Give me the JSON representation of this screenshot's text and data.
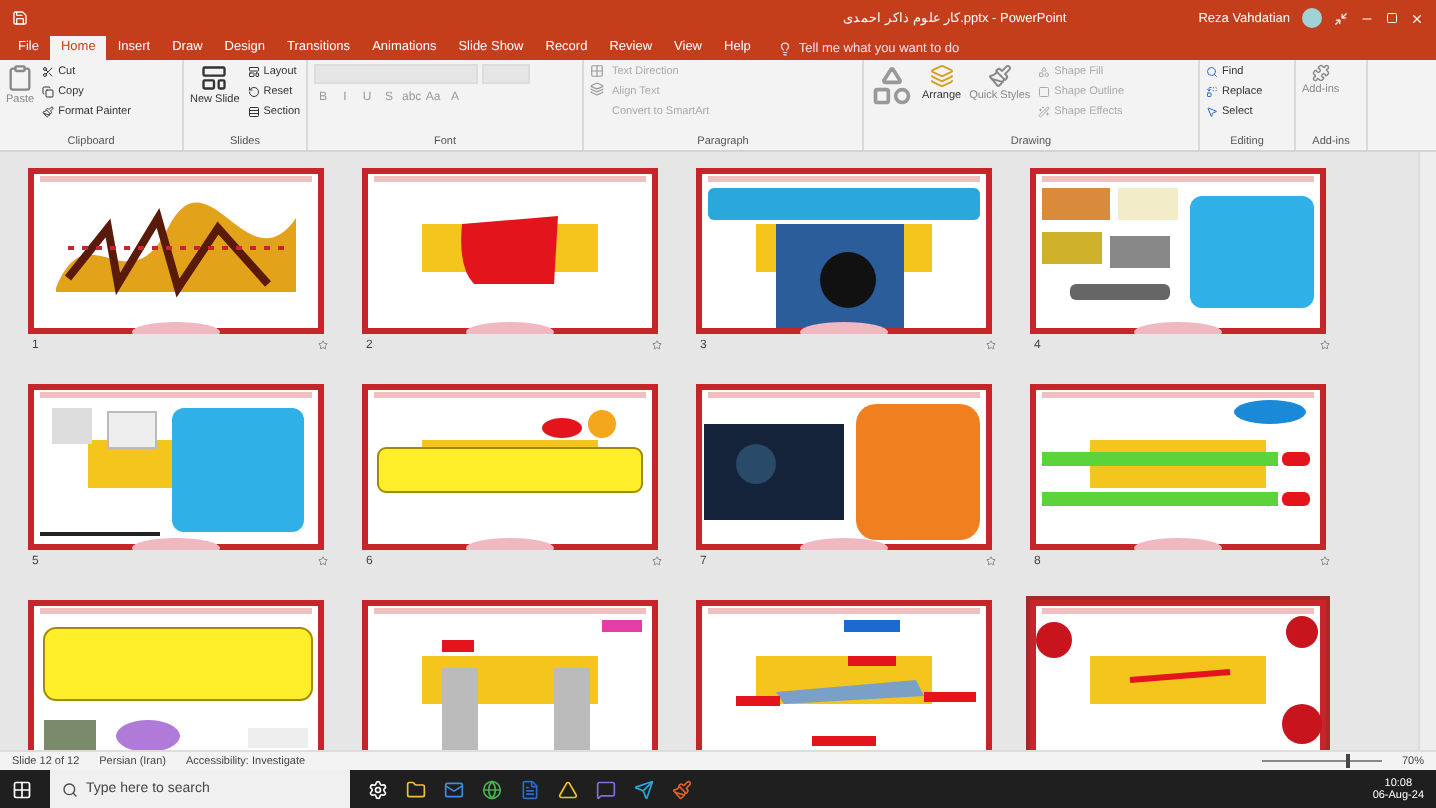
{
  "window": {
    "title": "کار علوم ذاکر احمدی.pptx - PowerPoint",
    "user": "Reza Vahdatian"
  },
  "tabs": [
    {
      "label": "File",
      "selected": false
    },
    {
      "label": "Home",
      "selected": true
    },
    {
      "label": "Insert",
      "selected": false
    },
    {
      "label": "Draw",
      "selected": false
    },
    {
      "label": "Design",
      "selected": false
    },
    {
      "label": "Transitions",
      "selected": false
    },
    {
      "label": "Animations",
      "selected": false
    },
    {
      "label": "Slide Show",
      "selected": false
    },
    {
      "label": "Record",
      "selected": false
    },
    {
      "label": "Review",
      "selected": false
    },
    {
      "label": "View",
      "selected": false
    },
    {
      "label": "Help",
      "selected": false
    }
  ],
  "tell_me": {
    "placeholder": "Tell me what you want to do"
  },
  "ribbon": {
    "clipboard": {
      "label": "Clipboard",
      "paste": "Paste",
      "items": [
        "Cut",
        "Copy",
        "Format Painter"
      ]
    },
    "slides": {
      "label": "Slides",
      "new_slide": "New Slide",
      "items": [
        "Layout",
        "Reset",
        "Section"
      ]
    },
    "font": {
      "label": "Font",
      "buttons": [
        "B",
        "I",
        "U",
        "S",
        "abc",
        "Aa",
        "A"
      ]
    },
    "paragraph": {
      "label": "Paragraph",
      "items": [
        "Text Direction",
        "Align Text",
        "Convert to SmartArt"
      ]
    },
    "drawing": {
      "label": "Drawing",
      "arrange": "Arrange",
      "quick_styles": "Quick Styles",
      "items": [
        "Shape Fill",
        "Shape Outline",
        "Shape Effects"
      ]
    },
    "editing": {
      "label": "Editing",
      "items": [
        "Find",
        "Replace",
        "Select"
      ]
    },
    "addins": {
      "label": "Add-ins",
      "button": "Add-ins"
    }
  },
  "slides": [
    {
      "number": "1",
      "kind": "calligraphy",
      "selected": false
    },
    {
      "number": "2",
      "kind": "title",
      "selected": false
    },
    {
      "number": "3",
      "kind": "photo",
      "selected": false
    },
    {
      "number": "4",
      "kind": "images",
      "selected": false
    },
    {
      "number": "5",
      "kind": "callout",
      "selected": false
    },
    {
      "number": "6",
      "kind": "banner",
      "selected": false
    },
    {
      "number": "7",
      "kind": "video",
      "selected": false
    },
    {
      "number": "8",
      "kind": "list",
      "selected": false
    },
    {
      "kind": "paragraph",
      "selected": false
    },
    {
      "kind": "pillars",
      "selected": false
    },
    {
      "kind": "airplane",
      "selected": false
    },
    {
      "kind": "flowers",
      "selected": true
    }
  ],
  "status_bar": {
    "slide": "Slide 12 of 12",
    "language": "Persian (Iran)",
    "accessibility": "Accessibility: Investigate",
    "zoom": "70%",
    "zoom_slider": {
      "level": 0.72
    }
  },
  "taskbar": {
    "search": {
      "placeholder": "Type here to search"
    },
    "time": "10:08",
    "date": "06-Aug-24"
  }
}
